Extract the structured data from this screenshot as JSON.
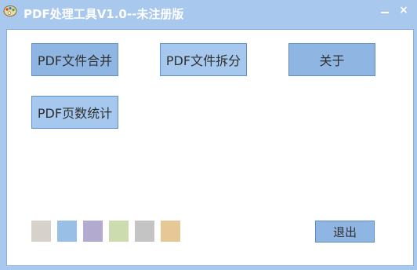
{
  "window": {
    "title": "PDF处理工具V1.0--未注册版",
    "icon": "palette-icon",
    "minimize_icon": "minimize-icon",
    "close_icon": "close-icon",
    "close_glyph": "×"
  },
  "buttons": {
    "merge_label": "PDF文件合并",
    "split_label": "PDF文件拆分",
    "about_label": "关于",
    "count_label": "PDF页数统计",
    "exit_label": "退出"
  },
  "theme_swatches": [
    {
      "color": "#d6d2cb"
    },
    {
      "color": "#99bfe6"
    },
    {
      "color": "#b3aad0"
    },
    {
      "color": "#cddcaf"
    },
    {
      "color": "#c4c4c4"
    },
    {
      "color": "#e5c896"
    }
  ],
  "colors": {
    "titlebar": "#a8c8ee",
    "button": "#8fb6e3",
    "button_border": "#5f8fc7"
  }
}
